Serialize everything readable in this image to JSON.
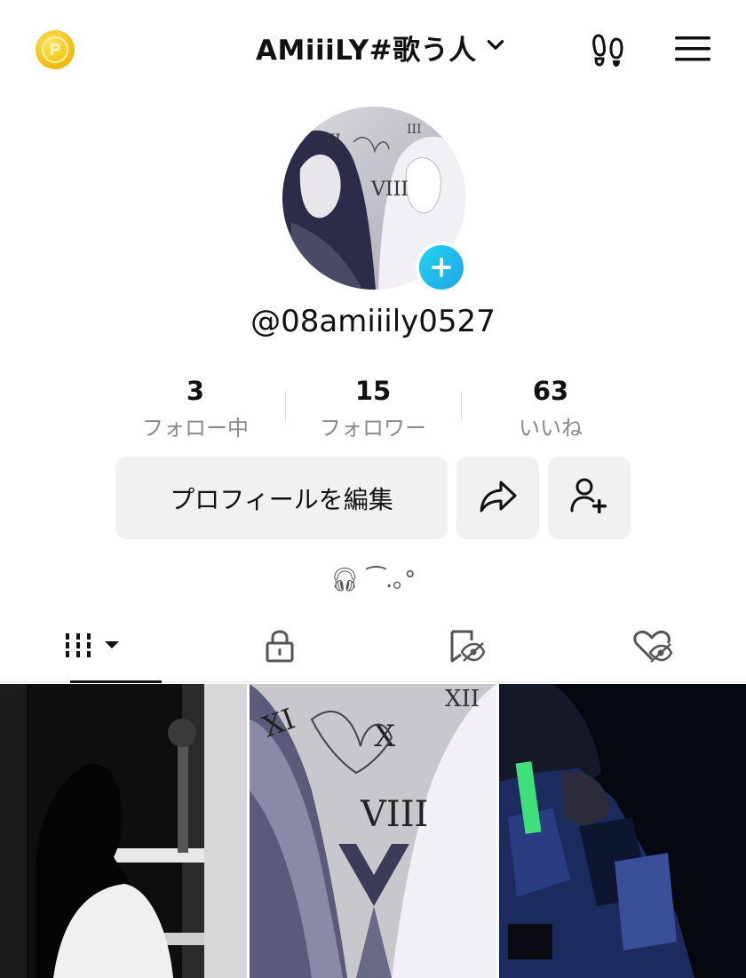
{
  "header": {
    "coin_icon": "coin-icon",
    "account_name": "AMiiiLY#歌う人",
    "dropdown_icon": "chevron-down-icon",
    "footprint_icon": "footprints-icon",
    "menu_icon": "hamburger-menu-icon"
  },
  "profile": {
    "handle": "@08amiiily0527",
    "avatar_badge_icon": "plus-icon"
  },
  "stats": [
    {
      "value": "3",
      "label": "フォロー中"
    },
    {
      "value": "15",
      "label": "フォロワー"
    },
    {
      "value": "63",
      "label": "いいね"
    }
  ],
  "actions": {
    "edit_profile": "プロフィールを編集",
    "share_icon": "share-arrow-icon",
    "add_friend_icon": "add-user-icon"
  },
  "bio": "🎧︎︎︎ ⁀.｡°",
  "tabs": [
    {
      "name": "videos",
      "icon": "grid-bars-icon",
      "active": true
    },
    {
      "name": "private",
      "icon": "lock-icon",
      "active": false
    },
    {
      "name": "saved-hidden",
      "icon": "bookmark-hidden-icon",
      "active": false
    },
    {
      "name": "liked-hidden",
      "icon": "heart-hidden-icon",
      "active": false
    }
  ],
  "colors": {
    "accent_badge": "#22c3ee",
    "coin": "#f5c012",
    "button_bg": "#f1f1f2",
    "muted_text": "#8a8a8a"
  }
}
